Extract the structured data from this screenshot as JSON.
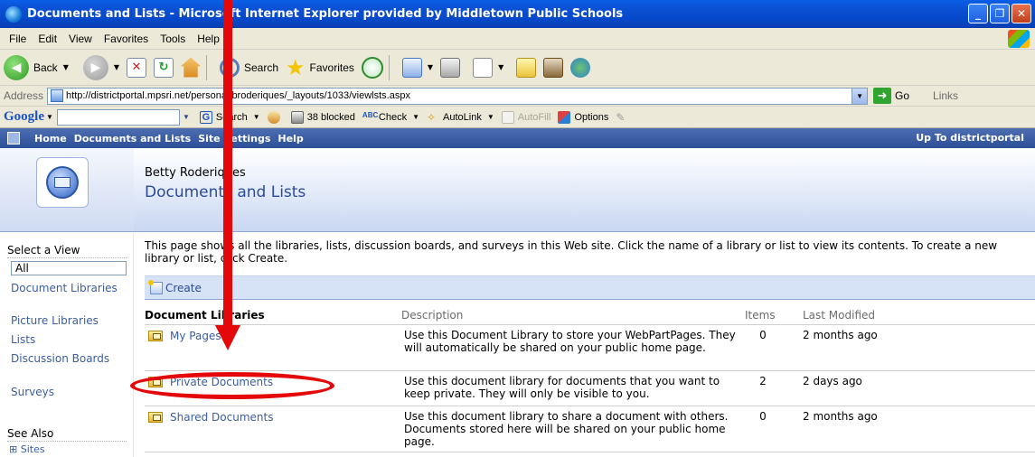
{
  "window": {
    "title": "Documents and Lists - Microsoft Internet Explorer provided by Middletown Public Schools",
    "controls": {
      "minimize": "_",
      "maximize": "❐",
      "close": "✕"
    }
  },
  "menu": [
    "File",
    "Edit",
    "View",
    "Favorites",
    "Tools",
    "Help"
  ],
  "toolbar": {
    "back_label": "Back",
    "search_label": "Search",
    "favorites_label": "Favorites"
  },
  "address": {
    "label": "Address",
    "url": "http://districtportal.mpsri.net/personal/broderiques/_layouts/1033/viewlsts.aspx",
    "go_label": "Go",
    "links_label": "Links"
  },
  "google": {
    "logo": "Google",
    "search_label": "Search",
    "blocked_label": "38 blocked",
    "check_label": "Check",
    "autolink_label": "AutoLink",
    "autofill_label": "AutoFill",
    "options_label": "Options"
  },
  "sp_nav": {
    "items": [
      "Home",
      "Documents and Lists",
      "Site Settings",
      "Help"
    ],
    "up_to": "Up To districtportal"
  },
  "header": {
    "owner": "Betty Roderiques",
    "title": "Documents and Lists"
  },
  "left_nav": {
    "select_heading": "Select a View",
    "selected": "All",
    "views": [
      "Document Libraries",
      "Picture Libraries",
      "Lists",
      "Discussion Boards",
      "Surveys"
    ],
    "see_also_heading": "See Also",
    "see_also_items": [
      "Sites"
    ]
  },
  "main": {
    "intro": "This page shows all the libraries, lists, discussion boards, and surveys in this Web site. Click the name of a library or list to view its contents. To create a new library or list, click Create.",
    "create_label": "Create",
    "columns": [
      "Document Libraries",
      "Description",
      "Items",
      "Last Modified"
    ],
    "libraries": [
      {
        "name": "My Pages",
        "description": "Use this Document Library to store your WebPartPages. They will automatically be shared on your public home page.",
        "items": "0",
        "modified": "2 months ago"
      },
      {
        "name": "Private Documents",
        "description": "Use this document library for documents that you want to keep private.  They will only be visible to you.",
        "items": "2",
        "modified": "2 days ago"
      },
      {
        "name": "Shared Documents",
        "description": "Use this document library to share a document with others. Documents stored here will be shared on your public home page.",
        "items": "0",
        "modified": "2 months ago"
      }
    ]
  },
  "colors": {
    "annotation_red": "#e4080a",
    "sp_nav_blue": "#2d4f98",
    "link_blue": "#3b5d9c"
  }
}
